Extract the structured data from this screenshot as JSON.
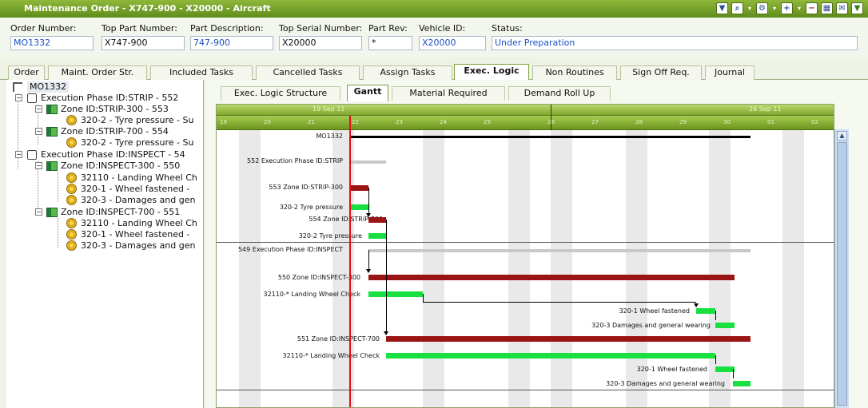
{
  "window": {
    "title": "Maintenance Order - X747-900 - X20000 - Aircraft",
    "icons": [
      "save-icon",
      "search-icon",
      "settings-icon",
      "add-icon",
      "remove-icon",
      "grid-icon",
      "mail-icon"
    ]
  },
  "header": {
    "order_number": {
      "label": "Order Number:",
      "value": "MO1332"
    },
    "top_part_number": {
      "label": "Top Part Number:",
      "value": "X747-900"
    },
    "part_description": {
      "label": "Part Description:",
      "value": "747-900"
    },
    "top_serial_number": {
      "label": "Top Serial Number:",
      "value": "X20000"
    },
    "part_rev": {
      "label": "Part Rev:",
      "value": "*"
    },
    "vehicle_id": {
      "label": "Vehicle ID:",
      "value": "X20000"
    },
    "status": {
      "label": "Status:",
      "value": "Under Preparation"
    }
  },
  "tabs": [
    "Order",
    "Maint. Order Str.",
    "Included Tasks",
    "Cancelled Tasks",
    "Assign Tasks",
    "Exec. Logic",
    "Non Routines",
    "Sign Off Req.",
    "Journal"
  ],
  "active_tab": "Exec. Logic",
  "tree": {
    "root": "MO1332",
    "items": [
      "Execution Phase ID:STRIP - 552",
      "Zone ID:STRIP-300 - 553",
      "320-2 - Tyre pressure - Su",
      "Zone ID:STRIP-700 - 554",
      "320-2 - Tyre pressure - Su",
      "Execution Phase ID:INSPECT - 54",
      "Zone ID:INSPECT-300 - 550",
      "32110 - Landing Wheel Ch",
      "320-1 - Wheel fastened -",
      "320-3 - Damages and gen",
      "Zone ID:INSPECT-700 - 551",
      "32110 - Landing Wheel Ch",
      "320-1 - Wheel fastened -",
      "320-3 - Damages and gen"
    ]
  },
  "subtabs": [
    "Exec. Logic Structure",
    "Gantt",
    "Material Required",
    "Demand Roll Up"
  ],
  "active_subtab": "Gantt",
  "gantt": {
    "weeks": [
      "19 Sep 11",
      "26 Sep 11"
    ],
    "days": [
      "19",
      "20",
      "21",
      "22",
      "23",
      "24",
      "25",
      "26",
      "27",
      "28",
      "29",
      "30",
      "01",
      "02"
    ],
    "rows": [
      {
        "label": "MO1332",
        "kind": "black"
      },
      {
        "label": "552 Execution Phase ID:STRIP",
        "kind": "gray"
      },
      {
        "label": "553 Zone ID:STRIP-300",
        "kind": "red"
      },
      {
        "label": "320-2 Tyre pressure",
        "kind": "green"
      },
      {
        "label": "554 Zone ID:STRIP-700",
        "kind": "red"
      },
      {
        "label": "320-2 Tyre pressure",
        "kind": "green"
      },
      {
        "label": "549 Execution Phase ID:INSPECT",
        "kind": "gray"
      },
      {
        "label": "550 Zone ID:INSPECT-300",
        "kind": "red"
      },
      {
        "label": "32110-* Landing Wheel Check",
        "kind": "green"
      },
      {
        "label": "320-1 Wheel fastened",
        "kind": "green"
      },
      {
        "label": "320-3 Damages and general wearing",
        "kind": "green"
      },
      {
        "label": "551 Zone ID:INSPECT-700",
        "kind": "red"
      },
      {
        "label": "32110-* Landing Wheel Check",
        "kind": "green"
      },
      {
        "label": "320-1 Wheel fastened",
        "kind": "green"
      },
      {
        "label": "320-3 Damages and general wearing",
        "kind": "green"
      }
    ]
  }
}
